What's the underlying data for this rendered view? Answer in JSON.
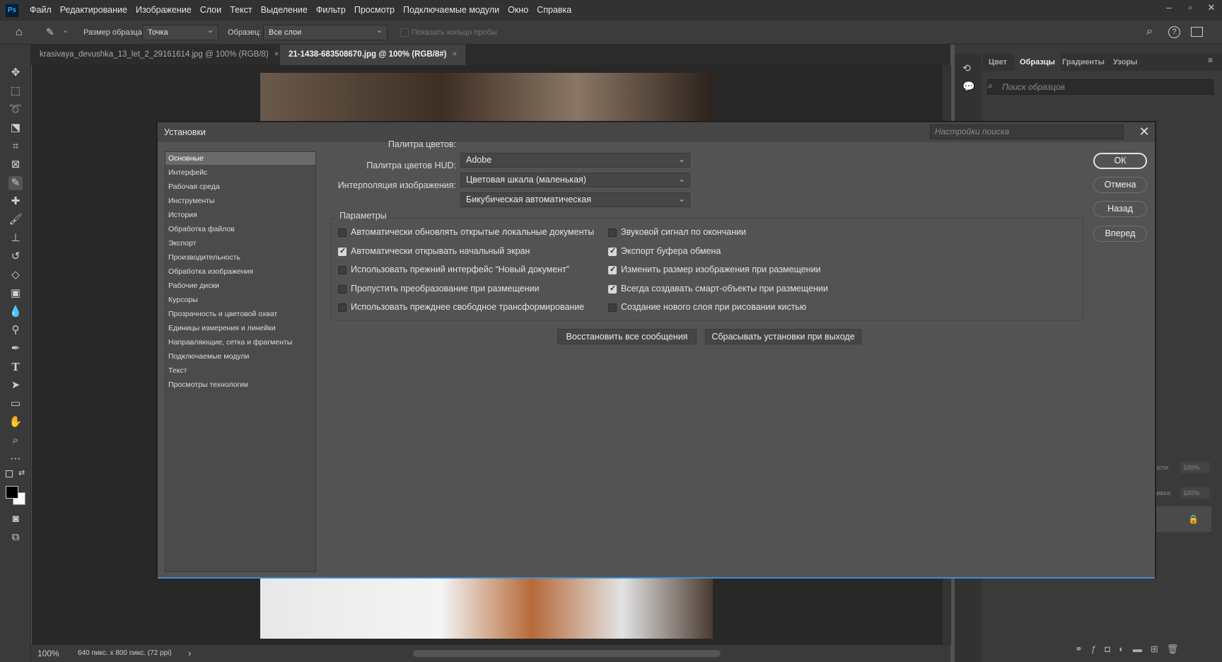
{
  "app": {
    "logo": "Ps",
    "menu": [
      "Файл",
      "Редактирование",
      "Изображение",
      "Слои",
      "Текст",
      "Выделение",
      "Фильтр",
      "Просмотр",
      "Подключаемые модули",
      "Окно",
      "Справка"
    ],
    "window_controls": {
      "minimize": "–",
      "restore": "▫",
      "close": "✕"
    }
  },
  "options_bar": {
    "sample_size_label": "Размер образца:",
    "sample_size_value": "Точка",
    "sample_label": "Образец:",
    "sample_value": "Все слои",
    "show_ring_label": "Показать кольцо пробы"
  },
  "tabs": [
    {
      "label": "krasivaya_devushka_13_let_2_29161614.jpg @ 100% (RGB/8)",
      "close": "×"
    },
    {
      "label": "21-1438-683508670.jpg @ 100% (RGB/8#)",
      "close": "×"
    }
  ],
  "status": {
    "zoom": "100%",
    "info": "640 пикс. x 800 пикс. (72 ppi)",
    "arrow": "›"
  },
  "panel": {
    "tabs": [
      "Цвет",
      "Образцы",
      "Градиенты",
      "Узоры"
    ],
    "active_tab": "Образцы",
    "search_placeholder": "Поиск образцов",
    "opacity_label": "ности:",
    "opacity_value": "100%",
    "fill_label": "ливка:",
    "fill_value": "100%"
  },
  "dialog": {
    "title": "Установки",
    "search_placeholder": "Настройки поиска",
    "close": "✕",
    "categories": [
      "Основные",
      "Интерфейс",
      "Рабочая среда",
      "Инструменты",
      "История",
      "Обработка файлов",
      "Экспорт",
      "Производительность",
      "Обработка изображения",
      "Рабочие диски",
      "Курсоры",
      "Прозрачность и цветовой охват",
      "Единицы измерения и линейки",
      "Направляющие, сетка и фрагменты",
      "Подключаемые модули",
      "Текст",
      "Просмотры технологии"
    ],
    "selected_category": "Основные",
    "fields": {
      "color_picker_label": "Палитра цветов:",
      "color_picker_value": "Adobe",
      "hud_picker_label": "Палитра цветов HUD:",
      "hud_picker_value": "Цветовая шкала (маленькая)",
      "interp_label": "Интерполяция изображения:",
      "interp_value": "Бикубическая автоматическая"
    },
    "params_title": "Параметры",
    "options_left": [
      {
        "label": "Автоматически обновлять открытые локальные документы",
        "checked": false
      },
      {
        "label": "Автоматически открывать начальный экран",
        "checked": true
      },
      {
        "label": "Использовать прежний интерфейс “Новый документ”",
        "checked": false
      },
      {
        "label": "Пропустить преобразование при размещении",
        "checked": false
      },
      {
        "label": "Использовать прежднее свободное трансформирование",
        "checked": false
      }
    ],
    "options_right": [
      {
        "label": "Звуковой сигнал по окончании",
        "checked": false
      },
      {
        "label": "Экспорт буфера обмена",
        "checked": true
      },
      {
        "label": "Изменить размер изображения при размещении",
        "checked": true
      },
      {
        "label": "Всегда создавать смарт-объекты при размещении",
        "checked": true
      },
      {
        "label": "Создание нового слоя при рисовании кистью",
        "checked": false
      }
    ],
    "buttons": {
      "reset_messages": "Восстановить все сообщения",
      "reset_on_quit": "Сбрасывать установки при выходе",
      "ok": "ОК",
      "cancel": "Отмена",
      "prev": "Назад",
      "next": "Вперед"
    }
  }
}
